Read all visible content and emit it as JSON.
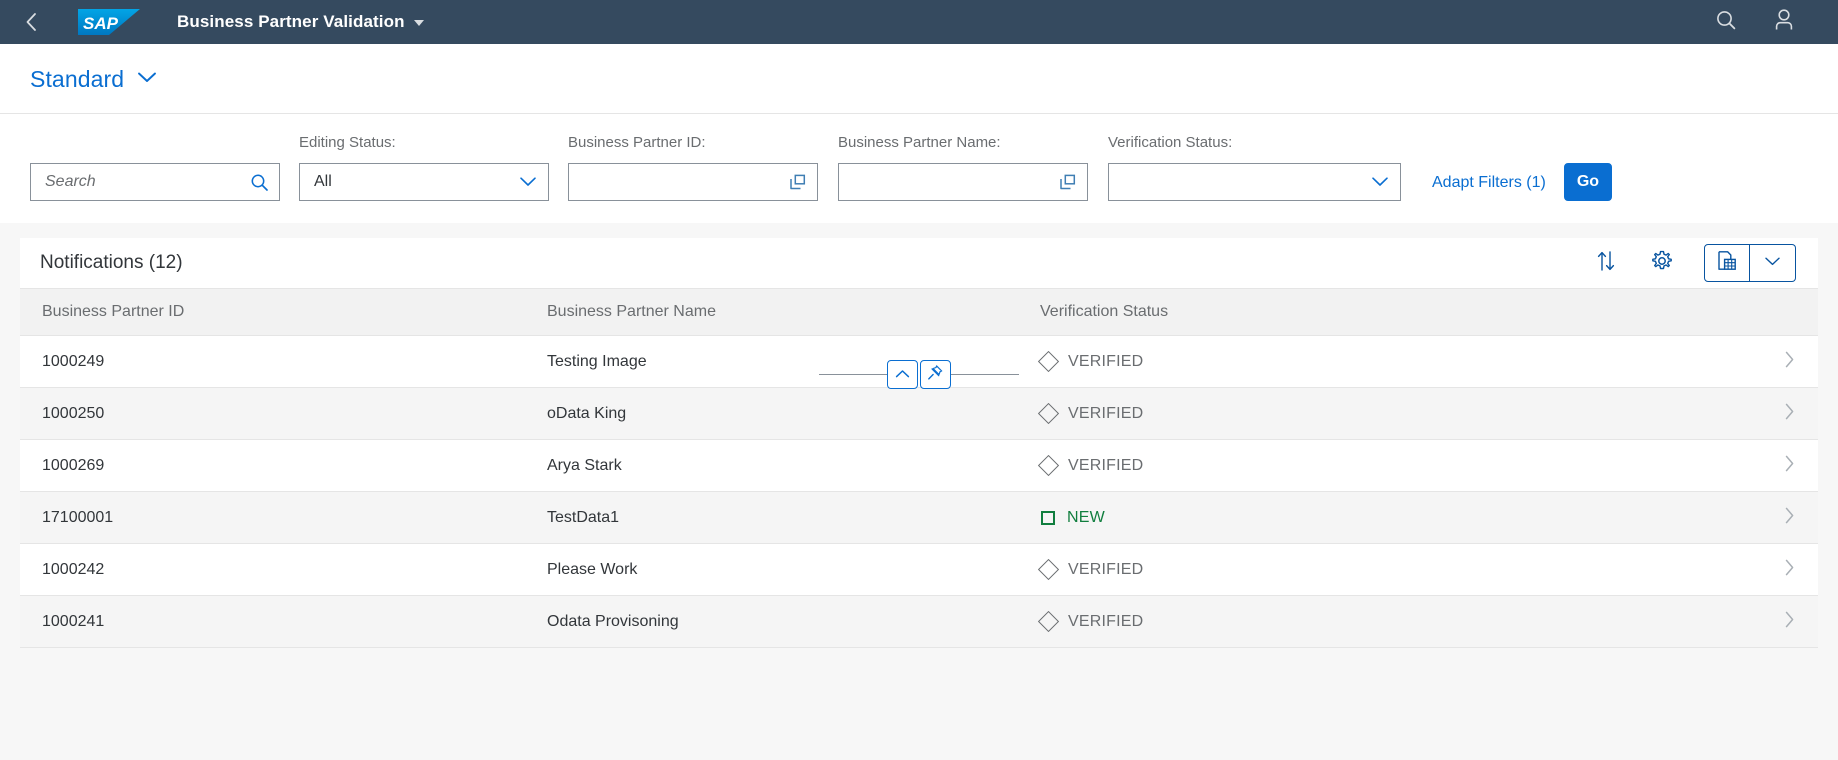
{
  "shellbar": {
    "back_icon": "chevron-left-icon",
    "logo_text": "SAP",
    "title": "Business Partner Validation",
    "title_caret_icon": "caret-down-icon",
    "search_icon": "search-icon",
    "user_icon": "user-account-icon",
    "bg_color": "#354a5f"
  },
  "page_header": {
    "variant_label": "Standard",
    "variant_caret_icon": "chevron-down-icon",
    "accent_color": "#0a6ed1"
  },
  "filterbar": {
    "search": {
      "label": "",
      "placeholder": "Search",
      "value": "",
      "icon": "search-icon"
    },
    "fields": [
      {
        "label": "Editing Status:",
        "type": "select",
        "value": "All",
        "icon": "chevron-down-icon",
        "placeholder": ""
      },
      {
        "label": "Business Partner ID:",
        "type": "input",
        "value": "",
        "icon": "value-help-icon",
        "placeholder": ""
      },
      {
        "label": "Business Partner Name:",
        "type": "input",
        "value": "",
        "icon": "value-help-icon",
        "placeholder": ""
      },
      {
        "label": "Verification Status:",
        "type": "select",
        "value": "",
        "icon": "chevron-down-icon",
        "placeholder": ""
      }
    ],
    "adapt_filters_label": "Adapt Filters (1)",
    "go_label": "Go",
    "collapse_icon": "chevron-up-icon",
    "pin_icon": "pushpin-icon"
  },
  "table": {
    "title": "Notifications (12)",
    "toolbar": {
      "sort_icon": "sort-icon",
      "settings_icon": "gear-icon",
      "export_icon": "export-to-spreadsheet-icon",
      "export_menu_icon": "chevron-down-icon"
    },
    "columns": [
      "Business Partner ID",
      "Business Partner Name",
      "Verification Status"
    ],
    "rows": [
      {
        "id": "1000249",
        "name": "Testing Image",
        "status": "VERIFIED",
        "status_kind": "verified",
        "status_icon": "diamond-outline-icon",
        "nav_icon": "chevron-right-icon"
      },
      {
        "id": "1000250",
        "name": "oData King",
        "status": "VERIFIED",
        "status_kind": "verified",
        "status_icon": "diamond-outline-icon",
        "nav_icon": "chevron-right-icon"
      },
      {
        "id": "1000269",
        "name": "Arya Stark",
        "status": "VERIFIED",
        "status_kind": "verified",
        "status_icon": "diamond-outline-icon",
        "nav_icon": "chevron-right-icon"
      },
      {
        "id": "17100001",
        "name": "TestData1",
        "status": "NEW",
        "status_kind": "new",
        "status_icon": "square-outline-icon",
        "nav_icon": "chevron-right-icon"
      },
      {
        "id": "1000242",
        "name": "Please Work",
        "status": "VERIFIED",
        "status_kind": "verified",
        "status_icon": "diamond-outline-icon",
        "nav_icon": "chevron-right-icon"
      },
      {
        "id": "1000241",
        "name": "Odata Provisoning",
        "status": "VERIFIED",
        "status_kind": "verified",
        "status_icon": "diamond-outline-icon",
        "nav_icon": "chevron-right-icon"
      }
    ],
    "status_colors": {
      "verified": "#6a6d70",
      "new": "#107e3e"
    }
  }
}
